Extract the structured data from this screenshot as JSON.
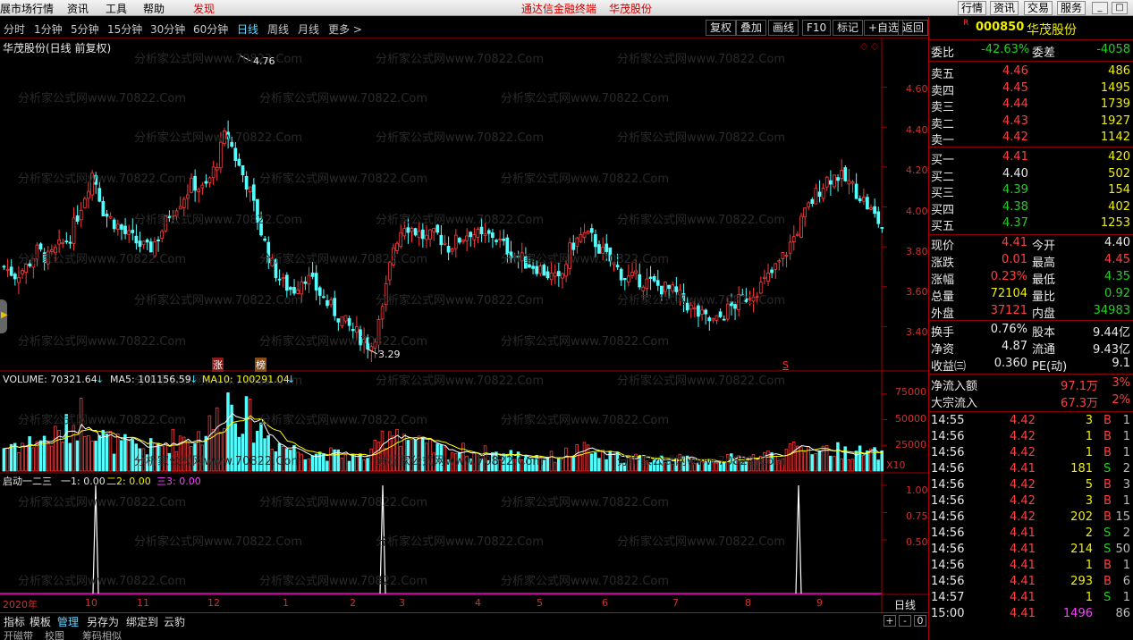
{
  "menu": {
    "left_items": [
      "展市场行情",
      "资讯",
      "工具",
      "帮助"
    ],
    "discover": "发现",
    "banner": "通达信金融终端",
    "banner_stock": "华茂股份",
    "right_buttons": [
      "行情",
      "资讯",
      "交易",
      "服务"
    ],
    "window_buttons": [
      "_",
      "□",
      "×"
    ]
  },
  "toolbar": {
    "periods": [
      "分时",
      "1分钟",
      "5分钟",
      "15分钟",
      "30分钟",
      "60分钟",
      "日线",
      "周线",
      "月线",
      "更多 >"
    ],
    "selected_period": "日线",
    "tools": [
      "复权",
      "叠加",
      "画线",
      "F10",
      "标记",
      "+自选",
      "返回"
    ]
  },
  "chart": {
    "title": "华茂股份(日线 前复权)",
    "high_label": "4.76",
    "low_label": "3.29",
    "price_axis": [
      "4.60",
      "4.40",
      "4.20",
      "4.00",
      "3.80",
      "3.60",
      "3.40"
    ],
    "markers": {
      "zhang": "涨",
      "bang": "榜",
      "s": "S"
    },
    "volume": {
      "label": "VOLUME: 70321.64",
      "ma5": "MA5: 101156.59",
      "ma10": "MA10: 100291.04",
      "axis": [
        "75000",
        "50000",
        "25000"
      ],
      "unit": "X10"
    },
    "indicator": {
      "name": "启动一二三",
      "l1": "一1: 0.00",
      "l2": "二2: 0.00",
      "l3": "三3: 0.00",
      "axis": [
        "1.00",
        "0.75",
        "0.50"
      ]
    },
    "date_axis": [
      "2020年",
      "10",
      "11",
      "12",
      "1",
      "2",
      "3",
      "4",
      "5",
      "6",
      "7",
      "8",
      "9"
    ],
    "period_label": "日线",
    "watermark": "分析家公式网www.70822.Com",
    "colors": {
      "up": "#ff3c3c",
      "down": "#54ffff",
      "ma5": "#ffffff",
      "ma10": "#ffff00",
      "frame": "#a00000"
    }
  },
  "chart_data": {
    "type": "candlestick",
    "price_axis": {
      "min": 3.2,
      "max": 4.8,
      "ticks": [
        3.4,
        3.6,
        3.8,
        4.0,
        4.2,
        4.4,
        4.6
      ]
    },
    "annotated_high": 4.76,
    "annotated_low": 3.29,
    "volume_axis": {
      "max": 80000,
      "ticks": [
        25000,
        50000,
        75000
      ],
      "unit": "X10"
    },
    "indicator_axis": {
      "ticks": [
        0.5,
        0.75,
        1.0
      ]
    },
    "indicator_spikes_at_months": [
      "10",
      "3",
      "9"
    ],
    "months": [
      "2020年",
      "10",
      "11",
      "12",
      "1",
      "2",
      "3",
      "4",
      "5",
      "6",
      "7",
      "8",
      "9"
    ],
    "close_trend": [
      3.7,
      3.66,
      3.7,
      3.78,
      3.74,
      3.8,
      3.86,
      4.02,
      4.18,
      3.97,
      3.92,
      3.86,
      3.82,
      3.78,
      3.86,
      3.98,
      4.04,
      4.12,
      4.08,
      4.2,
      4.38,
      4.22,
      4.1,
      3.9,
      3.72,
      3.62,
      3.58,
      3.66,
      3.6,
      3.52,
      3.46,
      3.4,
      3.35,
      3.3,
      3.46,
      3.8,
      3.92,
      3.88,
      3.84,
      3.86,
      3.8,
      3.84,
      3.88,
      3.84,
      3.86,
      3.8,
      3.76,
      3.72,
      3.7,
      3.66,
      3.62,
      3.8,
      3.86,
      3.84,
      3.76,
      3.7,
      3.64,
      3.64,
      3.62,
      3.6,
      3.58,
      3.54,
      3.48,
      3.44,
      3.42,
      3.48,
      3.52,
      3.56,
      3.6,
      3.66,
      3.74,
      3.84,
      3.96,
      4.06,
      4.14,
      4.16,
      4.12,
      4.06,
      3.98,
      3.9
    ],
    "volume_trend": [
      22000,
      26000,
      24000,
      30000,
      28000,
      34000,
      40000,
      52000,
      44000,
      30000,
      26000,
      24000,
      22000,
      21000,
      24000,
      28000,
      32000,
      30000,
      36000,
      44000,
      68000,
      56000,
      48000,
      40000,
      30000,
      24000,
      20000,
      18000,
      17000,
      16000,
      15000,
      14000,
      13000,
      14000,
      30000,
      42000,
      34000,
      26000,
      22000,
      20000,
      18000,
      19000,
      18000,
      17000,
      16000,
      15000,
      15000,
      14000,
      14000,
      13000,
      13000,
      18000,
      20000,
      16000,
      14000,
      13000,
      12000,
      12000,
      12000,
      11000,
      11000,
      11000,
      10000,
      10000,
      10000,
      11000,
      12000,
      13000,
      14000,
      15000,
      17000,
      19000,
      21000,
      22000,
      20000,
      19000,
      18000,
      17000,
      16000,
      15000
    ]
  },
  "panel": {
    "code_badge": "R",
    "code": "000850",
    "name": "华茂股份",
    "weibi_label": "委比",
    "weibi_value": "-42.63%",
    "weicha_label": "委差",
    "weicha_value": "-4058",
    "asks": [
      {
        "label": "卖五",
        "price": "4.46",
        "vol": "486"
      },
      {
        "label": "卖四",
        "price": "4.45",
        "vol": "1495"
      },
      {
        "label": "卖三",
        "price": "4.44",
        "vol": "1739"
      },
      {
        "label": "卖二",
        "price": "4.43",
        "vol": "1927"
      },
      {
        "label": "卖一",
        "price": "4.42",
        "vol": "1142"
      }
    ],
    "bids": [
      {
        "label": "买一",
        "price": "4.41",
        "vol": "420",
        "pcolor": "r"
      },
      {
        "label": "买二",
        "price": "4.40",
        "vol": "502",
        "pcolor": "w"
      },
      {
        "label": "买三",
        "price": "4.39",
        "vol": "154",
        "pcolor": "g"
      },
      {
        "label": "买四",
        "price": "4.38",
        "vol": "402",
        "pcolor": "g"
      },
      {
        "label": "买五",
        "price": "4.37",
        "vol": "1253",
        "pcolor": "g"
      }
    ],
    "stats": [
      {
        "l1": "现价",
        "v1": "4.41",
        "c1": "r",
        "l2": "今开",
        "v2": "4.40",
        "c2": "w"
      },
      {
        "l1": "涨跌",
        "v1": "0.01",
        "c1": "r",
        "l2": "最高",
        "v2": "4.45",
        "c2": "r"
      },
      {
        "l1": "涨幅",
        "v1": "0.23%",
        "c1": "r",
        "l2": "最低",
        "v2": "4.35",
        "c2": "g"
      },
      {
        "l1": "总量",
        "v1": "72104",
        "c1": "y",
        "l2": "量比",
        "v2": "0.92",
        "c2": "g"
      },
      {
        "l1": "外盘",
        "v1": "37121",
        "c1": "r",
        "l2": "内盘",
        "v2": "34983",
        "c2": "g"
      }
    ],
    "stats2": [
      {
        "l1": "换手",
        "v1": "0.76%",
        "l2": "股本",
        "v2": "9.44亿"
      },
      {
        "l1": "净资",
        "v1": "4.87",
        "l2": "流通",
        "v2": "9.43亿"
      },
      {
        "l1": "收益㈢",
        "v1": "0.360",
        "l2": "PE(动)",
        "v2": "9.1"
      }
    ],
    "flows": [
      {
        "label": "净流入额",
        "value": "97.1万",
        "pct": "3%"
      },
      {
        "label": "大宗流入",
        "value": "67.3万",
        "pct": "2%"
      }
    ],
    "ticks": [
      {
        "time": "14:55",
        "price": "4.42",
        "vol": "3",
        "bs": "B",
        "n": "1"
      },
      {
        "time": "14:56",
        "price": "4.42",
        "vol": "1",
        "bs": "B",
        "n": "1"
      },
      {
        "time": "14:56",
        "price": "4.42",
        "vol": "1",
        "bs": "B",
        "n": "1"
      },
      {
        "time": "14:56",
        "price": "4.41",
        "vol": "181",
        "bs": "S",
        "n": "2"
      },
      {
        "time": "14:56",
        "price": "4.42",
        "vol": "5",
        "bs": "B",
        "n": "3"
      },
      {
        "time": "14:56",
        "price": "4.42",
        "vol": "3",
        "bs": "B",
        "n": "1"
      },
      {
        "time": "14:56",
        "price": "4.42",
        "vol": "202",
        "bs": "B",
        "n": "15"
      },
      {
        "time": "14:56",
        "price": "4.41",
        "vol": "2",
        "bs": "S",
        "n": "2"
      },
      {
        "time": "14:56",
        "price": "4.41",
        "vol": "214",
        "bs": "S",
        "n": "50"
      },
      {
        "time": "14:56",
        "price": "4.41",
        "vol": "1",
        "bs": "B",
        "n": "1"
      },
      {
        "time": "14:56",
        "price": "4.41",
        "vol": "293",
        "bs": "B",
        "n": "6"
      },
      {
        "time": "14:57",
        "price": "4.41",
        "vol": "1",
        "bs": "S",
        "n": "1"
      },
      {
        "time": "15:00",
        "price": "4.41",
        "vol": "1496",
        "bs": "",
        "n": "86"
      }
    ]
  },
  "bottom": {
    "tabs": [
      "指标",
      "模板",
      "管理",
      "另存为",
      "绑定到",
      "云豹"
    ],
    "selected_tab": "管理",
    "sub_tabs": [
      "开磁带",
      "校图",
      "筹码相似"
    ],
    "zoom": [
      "+",
      "-",
      "0"
    ]
  }
}
